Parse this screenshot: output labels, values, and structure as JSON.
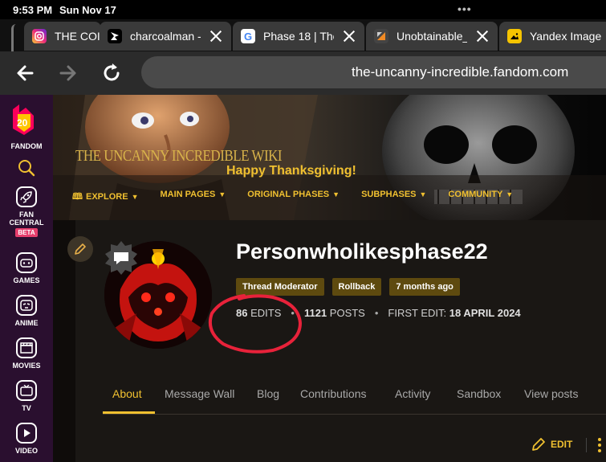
{
  "status_bar": {
    "time": "9:53 PM",
    "date": "Sun Nov 17",
    "dots": "•••"
  },
  "tabs": [
    {
      "title": "THE COI",
      "favicon": "instagram-icon",
      "fav_color": "#e1306c"
    },
    {
      "title": "charcoalman -",
      "favicon": "charcoal-icon",
      "fav_color": "#000000"
    },
    {
      "title": "Phase 18 | The",
      "favicon": "google-icon",
      "fav_color": "#ffffff"
    },
    {
      "title": "Unobtainable_",
      "favicon": "site-icon",
      "fav_color": "#333333"
    },
    {
      "title": "Yandex Image",
      "favicon": "yandex-images-icon",
      "fav_color": "#f5c400"
    }
  ],
  "nav": {
    "url": "the-uncanny-incredible.fandom.com"
  },
  "sidebar": {
    "logo_number": "20",
    "logo_label": "FANDOM",
    "items": [
      {
        "label": "FAN",
        "label2": "CENTRAL",
        "badge": "BETA"
      },
      {
        "label": "GAMES"
      },
      {
        "label": "ANIME"
      },
      {
        "label": "MOVIES"
      },
      {
        "label": "TV"
      },
      {
        "label": "VIDEO"
      }
    ]
  },
  "banner": {
    "wiki_title": "THE UNCANNY INCREDIBLE WIKI",
    "greeting": "Happy Thanksgiving!",
    "menu": [
      "EXPLORE",
      "MAIN PAGES",
      "ORIGINAL PHASES",
      "SUBPHASES",
      "COMMUNITY"
    ]
  },
  "profile": {
    "username": "Personwholikesphase22",
    "tags": [
      "Thread Moderator",
      "Rollback",
      "7 months ago"
    ],
    "edits_count": "86",
    "edits_label": "EDITS",
    "posts_count": "1121",
    "posts_label": "POSTS",
    "first_edit_label": "FIRST EDIT:",
    "first_edit_date": "18 APRIL 2024"
  },
  "profile_tabs": [
    "About",
    "Message Wall",
    "Blog",
    "Contributions",
    "Activity",
    "Sandbox",
    "View posts"
  ],
  "actions": {
    "edit_label": "EDIT"
  },
  "colors": {
    "accent": "#f0c030",
    "sidebar_bg": "#2a0f2f",
    "annotation": "#e8223a"
  }
}
